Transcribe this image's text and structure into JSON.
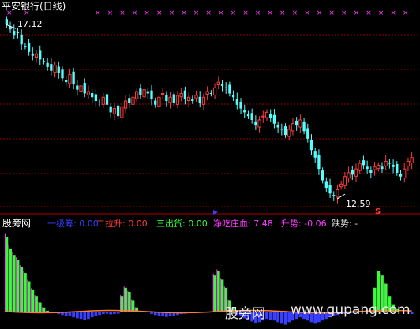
{
  "window": {
    "title": "平安银行(日线)"
  },
  "colors": {
    "up": "#ff3b3b",
    "down": "#54ffff",
    "signal": "#ff3cff",
    "grid": "#8a0000",
    "green": "#33ff33",
    "blue": "#3a40ff",
    "magenta": "#ff3cff",
    "orange": "#ff7a3b"
  },
  "main_chart": {
    "high_label": "17.12",
    "low_label": "12.59",
    "sell_marker": "S",
    "top_markers_count": 26,
    "chart_data": {
      "type": "candlestick",
      "series": [
        {
          "values": [
            17.12,
            17.0,
            16.85,
            16.9,
            16.6,
            16.55,
            16.4,
            16.3,
            16.35,
            16.2,
            16.15,
            16.0,
            15.9,
            16.05,
            15.85,
            15.7,
            15.6,
            15.8,
            15.55,
            15.4,
            15.5,
            15.3,
            15.35,
            15.2,
            15.1,
            15.05,
            15.2,
            15.0,
            14.8,
            14.9,
            14.7,
            14.95,
            15.1,
            15.05,
            15.2,
            15.35,
            15.25,
            15.4,
            15.3,
            15.15,
            15.0,
            15.2,
            15.3,
            15.1,
            15.2,
            15.05,
            15.25,
            15.3,
            15.15,
            15.2,
            15.1,
            15.25,
            15.05,
            15.2,
            15.35,
            15.3,
            15.45,
            15.6,
            15.5,
            15.45,
            15.3,
            15.2,
            15.0,
            14.9,
            14.8,
            14.7,
            14.6,
            14.45,
            14.6,
            14.7,
            14.8,
            14.65,
            14.5,
            14.4,
            14.35,
            14.2,
            14.35,
            14.5,
            14.45,
            14.6,
            14.3,
            14.1,
            13.8,
            13.6,
            13.3,
            13.0,
            12.8,
            12.65,
            12.59,
            12.75,
            12.9,
            13.1,
            13.2,
            13.15,
            13.3,
            13.45,
            13.4,
            13.3,
            13.2,
            13.35,
            13.4,
            13.3,
            13.5,
            13.45,
            13.35,
            13.2,
            13.1,
            13.3,
            13.5,
            13.6
          ]
        }
      ]
    }
  },
  "indicator": {
    "name": "股旁网",
    "legend": [
      {
        "label": "一级筹: 0.00",
        "color": "#3a40ff"
      },
      {
        "label": "二拉升: 0.00",
        "color": "#ff3b3b"
      },
      {
        "label": "三出货: 0.00",
        "color": "#33ff33"
      },
      {
        "label": "净吃庄血: 7.48",
        "color": "#ff3cff"
      },
      {
        "label": "升势: -0.06",
        "color": "#ff3cff"
      },
      {
        "label": "跌势: -",
        "color": "#dddddd"
      }
    ],
    "chart_data": {
      "type": "bar",
      "series": [
        {
          "values": [
            0.92,
            0.78,
            0.7,
            0.64,
            0.55,
            0.48,
            0.38,
            0.28,
            0.2,
            0.12,
            0.06,
            0.02,
            0,
            0,
            0,
            0,
            0,
            0,
            0,
            0,
            0,
            0,
            0,
            0,
            0,
            0,
            0,
            0,
            0,
            0,
            0,
            0.2,
            0.3,
            0.25,
            0.15,
            0.06,
            0,
            0,
            0,
            0,
            0,
            0,
            0,
            0,
            0,
            0,
            0,
            0,
            0,
            0,
            0,
            0,
            0,
            0,
            0,
            0,
            0.45,
            0.5,
            0.4,
            0.3,
            0.15,
            0.05,
            0,
            0,
            0,
            0,
            0,
            0,
            0,
            0,
            0,
            0,
            0,
            0,
            0,
            0,
            0,
            0,
            0,
            0,
            0,
            0,
            0,
            0,
            0,
            0,
            0,
            0,
            0,
            0,
            0,
            0,
            0,
            0,
            0,
            0,
            0,
            0,
            0,
            0.3,
            0.5,
            0.45,
            0.35,
            0.2,
            0.1,
            0.04,
            0,
            0,
            0,
            0
          ]
        },
        {
          "values": [
            0,
            0,
            0,
            0,
            0,
            0,
            0,
            0,
            0,
            0,
            0,
            0,
            0,
            0,
            -0.05,
            -0.08,
            -0.1,
            -0.12,
            -0.15,
            -0.18,
            -0.2,
            -0.22,
            -0.2,
            -0.15,
            -0.1,
            -0.08,
            -0.05,
            -0.04,
            -0.06,
            -0.05,
            -0.04,
            0,
            0,
            0,
            0,
            0,
            0,
            0,
            0,
            -0.05,
            -0.08,
            -0.1,
            -0.12,
            -0.14,
            -0.12,
            -0.1,
            -0.08,
            -0.05,
            -0.04,
            -0.02,
            0,
            0,
            0,
            0,
            0,
            0,
            0,
            0,
            0,
            0,
            0,
            0,
            -0.08,
            -0.12,
            -0.18,
            -0.22,
            -0.28,
            -0.32,
            -0.3,
            -0.25,
            -0.2,
            -0.22,
            -0.25,
            -0.3,
            -0.35,
            -0.38,
            -0.3,
            -0.25,
            -0.2,
            -0.15,
            -0.2,
            -0.25,
            -0.3,
            -0.35,
            -0.3,
            -0.25,
            -0.2,
            -0.15,
            -0.1,
            -0.08,
            -0.05,
            -0.04,
            -0.03,
            -0.02,
            0,
            0,
            0,
            0,
            0,
            0,
            0,
            0,
            0,
            0,
            0,
            0,
            0,
            0,
            0,
            -0.05,
            -0.1
          ]
        }
      ]
    }
  },
  "watermark": {
    "cn": "股旁网",
    "en": "www.gupang.com"
  }
}
